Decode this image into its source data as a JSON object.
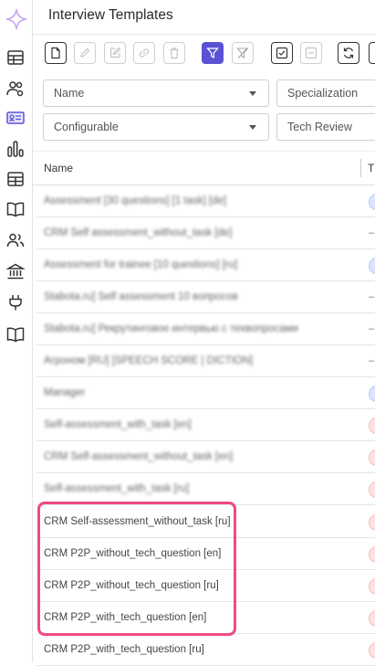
{
  "app": {
    "title": "Interview Templates"
  },
  "sidebar": {
    "icons": [
      "table-icon",
      "users-gear-icon",
      "id-card-icon",
      "bar-chart-icon",
      "grid-icon",
      "book-icon",
      "people-icon",
      "bank-icon",
      "plug-icon",
      "book-open-icon"
    ],
    "active_index": 2
  },
  "toolbar": {
    "buttons": [
      "new-document",
      "edit",
      "edit-alt",
      "link",
      "delete",
      "filter",
      "clear-filter",
      "check-all",
      "uncheck-all",
      "refresh"
    ]
  },
  "filters": {
    "name": "Name",
    "specialization": "Specialization",
    "configurable": "Configurable",
    "tech_review": "Tech Review"
  },
  "table": {
    "columns": {
      "name": "Name",
      "second": "T"
    },
    "rows": [
      {
        "name": "Assessment [30 questions] [1 task] [de]",
        "blurred": true,
        "mark": "blue"
      },
      {
        "name": "CRM Self assessment_without_task [de]",
        "blurred": true,
        "mark": "dash"
      },
      {
        "name": "Assessment for trainee [10 questions] [ru]",
        "blurred": true,
        "mark": "blue"
      },
      {
        "name": "Stabota.ru] Self assessment 10 вопросов",
        "blurred": true,
        "mark": "dash"
      },
      {
        "name": "Stabota.ru] Рекрутинговое интервью с техвопросами",
        "blurred": true,
        "mark": "dash"
      },
      {
        "name": "Агроном [RU] [SPEECH SCORE | DICTION]",
        "blurred": true,
        "mark": "dash"
      },
      {
        "name": "Manager",
        "blurred": true,
        "mark": "blue"
      },
      {
        "name": "Self-assessment_with_task [en]",
        "blurred": true,
        "mark": "red"
      },
      {
        "name": "CRM Self-assessment_without_task [en]",
        "blurred": true,
        "mark": "red"
      },
      {
        "name": "Self-assessment_with_task [ru]",
        "blurred": true,
        "mark": "red"
      },
      {
        "name": "CRM Self-assessment_without_task [ru]",
        "blurred": false,
        "mark": "red"
      },
      {
        "name": "CRM P2P_without_tech_question [en]",
        "blurred": false,
        "mark": "red"
      },
      {
        "name": "CRM P2P_without_tech_question [ru]",
        "blurred": false,
        "mark": "red"
      },
      {
        "name": "CRM P2P_with_tech_question [en]",
        "blurred": false,
        "mark": "red"
      },
      {
        "name": "CRM P2P_with_tech_question [ru]",
        "blurred": false,
        "mark": "red"
      }
    ],
    "dash": "–"
  }
}
